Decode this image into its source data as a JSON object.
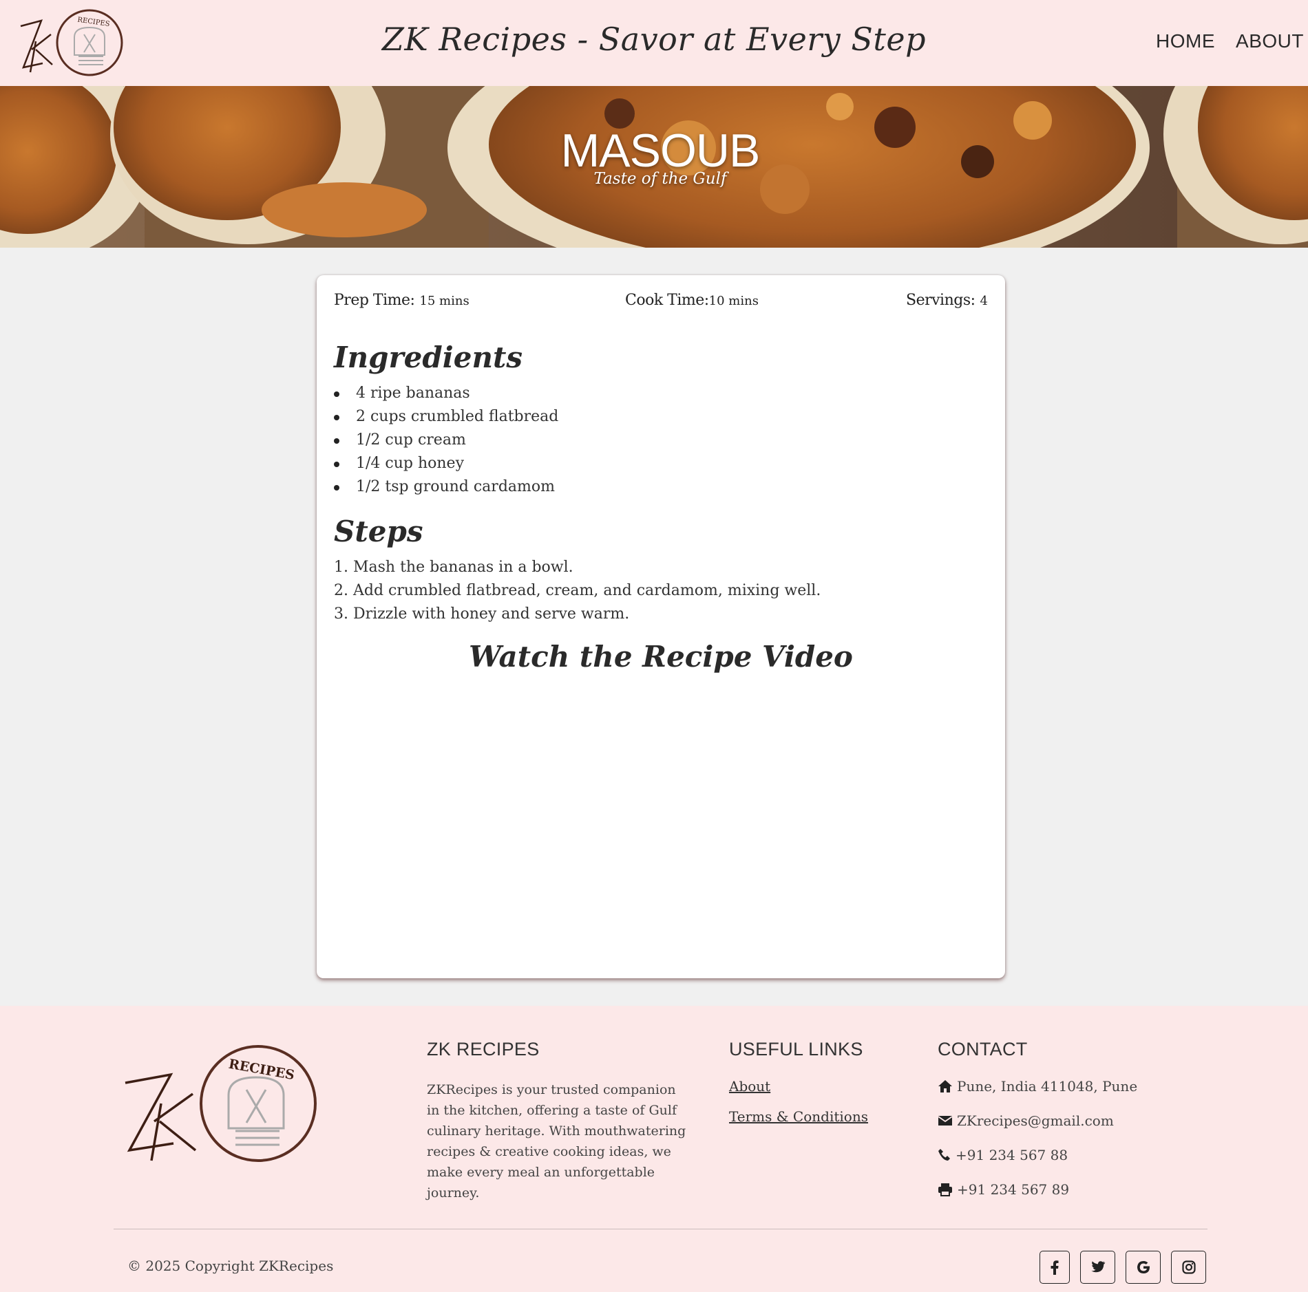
{
  "header": {
    "logo_text": "RECIPES",
    "logo_initials": "ZK",
    "title": "ZK Recipes - Savor at Every Step",
    "nav": [
      "HOME",
      "ABOUT"
    ]
  },
  "hero": {
    "title": "MASOUB",
    "subtitle": "Taste of the Gulf"
  },
  "recipe": {
    "prep_label": "Prep Time:",
    "prep_value": "15 mins",
    "cook_label": "Cook Time:",
    "cook_value": "10 mins",
    "servings_label": "Servings:",
    "servings_value": "4",
    "ingredients_heading": "Ingredients",
    "ingredients": [
      "4 ripe bananas",
      "2 cups crumbled flatbread",
      "1/2 cup cream",
      "1/4 cup honey",
      "1/2 tsp ground cardamom"
    ],
    "steps_heading": "Steps",
    "steps": [
      "1. Mash the bananas in a bowl.",
      "2. Add crumbled flatbread, cream, and cardamom, mixing well.",
      "3. Drizzle with honey and serve warm."
    ],
    "video_heading": "Watch the Recipe Video"
  },
  "footer": {
    "brand_heading": "ZK RECIPES",
    "brand_text": "ZKRecipes is your trusted companion in the kitchen, offering a taste of Gulf culinary heritage. With mouthwatering recipes & creative cooking ideas, we make every meal an unforgettable journey.",
    "links_heading": "USEFUL LINKS",
    "links": [
      "About",
      "Terms & Conditions"
    ],
    "contact_heading": "CONTACT",
    "address": "Pune, India 411048, Pune",
    "email": "ZKrecipes@gmail.com",
    "phone": "+91 234 567 88",
    "fax": "+91 234 567 89",
    "copyright": "© 2025 Copyright ZKRecipes",
    "socials": [
      "facebook-icon",
      "twitter-icon",
      "google-icon",
      "instagram-icon"
    ]
  },
  "colors": {
    "header_bg": "#fce8e8",
    "page_bg": "#f0f0f0",
    "logo_brown": "#5a2e22"
  }
}
